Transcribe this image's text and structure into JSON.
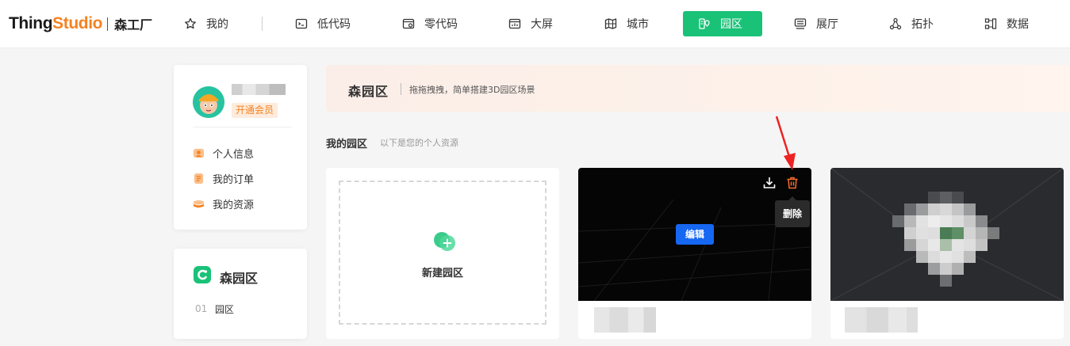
{
  "brand": {
    "name_part1": "Thing",
    "name_part2": "Studio",
    "name_cn": "森工厂"
  },
  "nav": {
    "mine": "我的",
    "lowcode": "低代码",
    "nocode": "零代码",
    "bigscreen": "大屏",
    "city": "城市",
    "park": "园区",
    "hall": "展厅",
    "topology": "拓扑",
    "data": "数据",
    "active": "园区"
  },
  "profile": {
    "vip_button": "开通会员",
    "menu": [
      "个人信息",
      "我的订单",
      "我的资源"
    ]
  },
  "park_panel": {
    "title": "森园区",
    "items": [
      {
        "num": "01",
        "label": "园区"
      }
    ]
  },
  "banner": {
    "title": "森园区",
    "subtitle": "拖拖拽拽，简单搭建3D园区场景"
  },
  "section": {
    "title": "我的园区",
    "subtitle": "以下是您的个人资源"
  },
  "new_card": {
    "label": "新建园区"
  },
  "project_card": {
    "edit_button": "编辑",
    "delete_tooltip": "删除"
  },
  "colors": {
    "accent_green": "#19c277",
    "brand_orange": "#f5821f",
    "edit_blue": "#1667f2",
    "delete_red": "#f56c2d"
  }
}
